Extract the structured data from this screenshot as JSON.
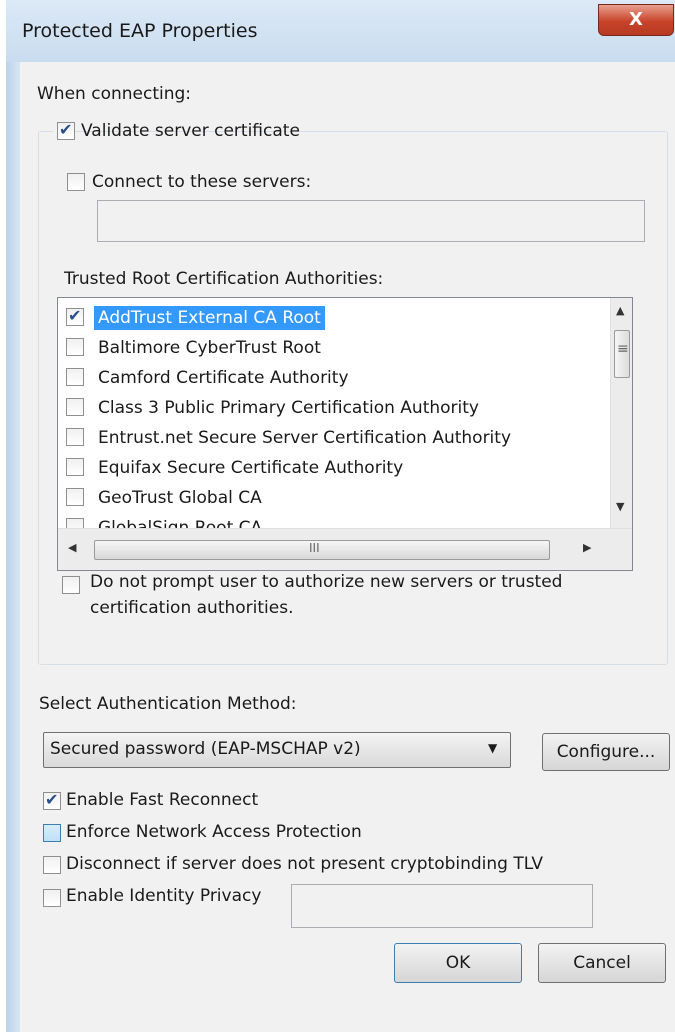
{
  "window": {
    "title": "Protected EAP Properties",
    "close_label": "X"
  },
  "when_connecting_label": "When connecting:",
  "validate": {
    "label": "Validate server certificate",
    "checked": true
  },
  "connect_servers": {
    "label": "Connect to these servers:",
    "checked": false,
    "value": ""
  },
  "trusted_label": "Trusted Root Certification Authorities:",
  "ca_list": [
    {
      "label": "AddTrust External CA Root",
      "checked": true,
      "selected": true
    },
    {
      "label": "Baltimore CyberTrust Root",
      "checked": false
    },
    {
      "label": "Camford Certificate Authority",
      "checked": false
    },
    {
      "label": "Class 3 Public Primary Certification Authority",
      "checked": false
    },
    {
      "label": "Entrust.net Secure Server Certification Authority",
      "checked": false
    },
    {
      "label": "Equifax Secure Certificate Authority",
      "checked": false
    },
    {
      "label": "GeoTrust Global CA",
      "checked": false
    },
    {
      "label": "GlobalSign Root CA",
      "checked": false
    }
  ],
  "scroll": {
    "up": "▲",
    "down": "▼",
    "left": "◀",
    "right": "▶",
    "grip_v": "≡",
    "grip_h": "III"
  },
  "no_prompt": {
    "label_line1": "Do not prompt user to authorize new servers or trusted",
    "label_line2": "certification authorities.",
    "checked": false
  },
  "auth_method_label": "Select Authentication Method:",
  "auth_method": {
    "value": "Secured password (EAP-MSCHAP v2)",
    "arrow": "▼"
  },
  "configure_label": "Configure...",
  "options": [
    {
      "label": "Enable Fast Reconnect",
      "checked": true
    },
    {
      "label": "Enforce Network Access Protection",
      "checked": false
    },
    {
      "label": "Disconnect if server does not present cryptobinding TLV",
      "checked": false
    },
    {
      "label": "Enable Identity Privacy",
      "checked": false
    }
  ],
  "identity_value": "",
  "ok_label": "OK",
  "cancel_label": "Cancel"
}
